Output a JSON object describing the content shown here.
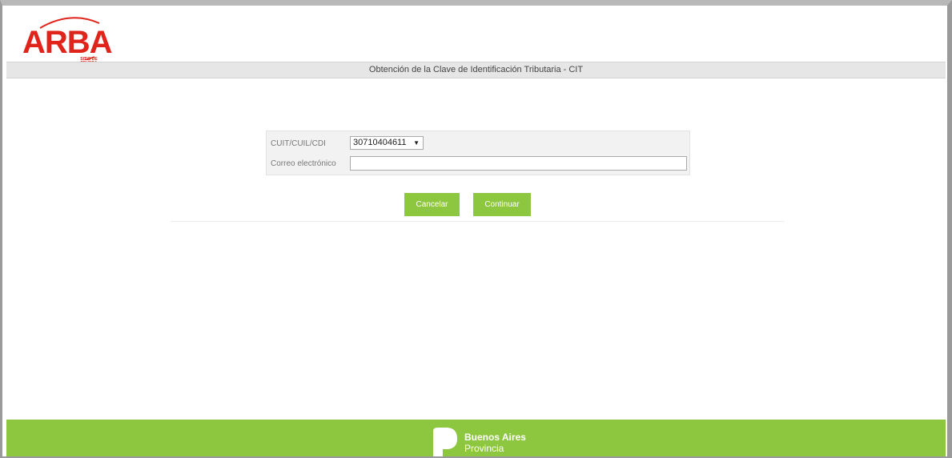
{
  "header": {
    "logo_text": "ARBA",
    "logo_subtext": "SITIO DE PRUEBA",
    "page_title": "Obtención de la Clave de Identificación Tributaria - CIT"
  },
  "form": {
    "cuit_label": "CUIT/CUIL/CDI",
    "cuit_selected": "30710404611",
    "email_label": "Correo electrónico",
    "email_value": ""
  },
  "actions": {
    "cancel_label": "Cancelar",
    "continue_label": "Continuar"
  },
  "footer": {
    "brand_title": "Buenos Aires",
    "brand_sub": "Provincia"
  },
  "colors": {
    "brand_red": "#e0231b",
    "accent_green": "#8dc63f",
    "title_bar": "#e6e6e6"
  }
}
